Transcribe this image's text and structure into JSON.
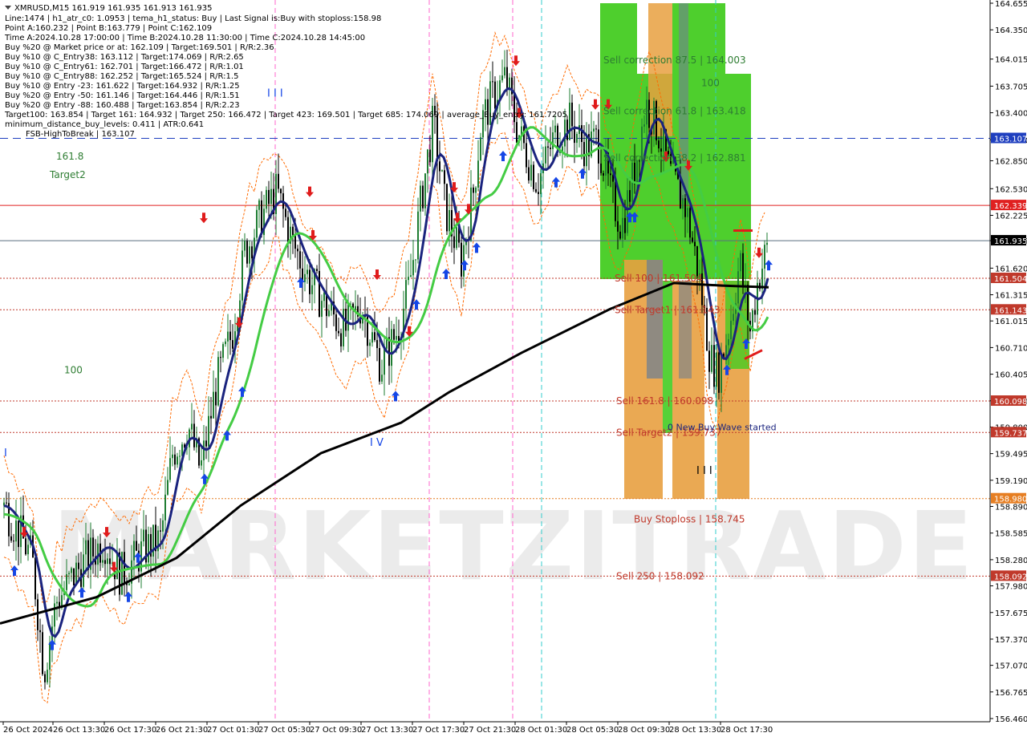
{
  "chart_data": {
    "type": "candlestick",
    "title": "XMRUSD,M15  161.919 161.935 161.913 161.935",
    "info_lines": [
      "Line:1474 | h1_atr_c0: 1.0953 | tema_h1_status: Buy | Last Signal is:Buy with stoploss:158.98",
      "Point A:160.232 | Point B:163.779 | Point C:162.109",
      "Time A:2024.10.28 17:00:00 | Time B:2024.10.28 11:30:00 | Time C:2024.10.28 14:45:00",
      "Buy %20 @ Market price or at: 162.109 | Target:169.501 | R/R:2.36",
      "Buy %10 @ C_Entry38: 163.112 | Target:174.069 | R/R:2.65",
      "Buy %10 @ C_Entry61: 162.701 | Target:166.472 | R/R:1.01",
      "Buy %10 @ C_Entry88: 162.252 | Target:165.524 | R/R:1.5",
      "Buy %10 @ Entry -23: 161.622 | Target:164.932 | R/R:1.25",
      "Buy %20 @ Entry -50: 161.146 | Target:164.446 | R/R:1.51",
      "Buy %20 @ Entry -88: 160.488 | Target:163.854 | R/R:2.23",
      "Target100: 163.854 | Target 161: 164.932 | Target 250: 166.472 | Target 423: 169.501 | Target 685: 174.069 | average_Buy_entry: 161.7205",
      "minimum_distance_buy_levels: 0.411 | ATR:0.641",
      "FSB-HighToBreak | 163.107"
    ],
    "y_ticks": [
      "164.655",
      "164.350",
      "164.015",
      "163.705",
      "163.400",
      "163.090",
      "162.850",
      "162.530",
      "162.225",
      "161.935",
      "161.620",
      "161.315",
      "161.015",
      "160.710",
      "160.405",
      "160.100",
      "159.800",
      "159.495",
      "159.190",
      "158.890",
      "158.585",
      "158.280",
      "157.980",
      "157.675",
      "157.370",
      "157.070",
      "156.765",
      "156.460"
    ],
    "x_labels": [
      "26 Oct 2024",
      "26 Oct 13:30",
      "26 Oct 17:30",
      "26 Oct 21:30",
      "27 Oct 01:30",
      "27 Oct 05:30",
      "27 Oct 09:30",
      "27 Oct 13:30",
      "27 Oct 17:30",
      "27 Oct 21:30",
      "28 Oct 01:30",
      "28 Oct 05:30",
      "28 Oct 09:30",
      "28 Oct 13:30",
      "28 Oct 17:30"
    ],
    "ylim": [
      156.46,
      164.655
    ],
    "current_price": "161.935",
    "price_tags": [
      {
        "value": 163.107,
        "label": "163.107",
        "color": "#1f3fbf",
        "style": "dashed"
      },
      {
        "value": 162.339,
        "label": "162.339",
        "color": "#e02020",
        "style": "solid"
      },
      {
        "value": 161.504,
        "label": "161.504",
        "color": "#c0392b",
        "style": "dotted"
      },
      {
        "value": 161.143,
        "label": "161.143",
        "color": "#c0392b",
        "style": "dotted"
      },
      {
        "value": 160.098,
        "label": "160.098",
        "color": "#c0392b",
        "style": "dotted"
      },
      {
        "value": 159.737,
        "label": "159.737",
        "color": "#c0392b",
        "style": "dotted"
      },
      {
        "value": 158.98,
        "label": "158.980",
        "color": "#e67e22",
        "style": "dotted"
      },
      {
        "value": 158.092,
        "label": "158.092",
        "color": "#c0392b",
        "style": "dotted"
      }
    ],
    "zone_labels": [
      {
        "text": "Sell correction 87.5 | 164.003",
        "price": 164.003,
        "color": "#2e7d32"
      },
      {
        "text": "Sell correction 61.8 | 163.418",
        "price": 163.418,
        "color": "#2e7d32"
      },
      {
        "text": "Sell correction 38.2 | 162.881",
        "price": 162.881,
        "color": "#2e7d32"
      },
      {
        "text": "Sell 100 | 161.504",
        "price": 161.504,
        "color": "#c0392b"
      },
      {
        "text": "Sell Target1 | 161.143",
        "price": 161.143,
        "color": "#c0392b"
      },
      {
        "text": "Sell 161.8 | 160.098",
        "price": 160.098,
        "color": "#c0392b"
      },
      {
        "text": "Sell Target2 | 159.737",
        "price": 159.737,
        "color": "#c0392b"
      },
      {
        "text": "Buy Stoploss | 158.745",
        "price": 158.745,
        "color": "#c0392b"
      },
      {
        "text": "Sell 250 | 158.092",
        "price": 158.092,
        "color": "#c0392b"
      }
    ],
    "side_labels": {
      "fib_161": "161.8",
      "target2": "Target2",
      "fib_100": "100",
      "zone_100": "100"
    },
    "wave_note": "0 New Buy Wave started",
    "roman_marks": {
      "m1": "I I I",
      "m2": "I V",
      "m3": "I I I",
      "m4": "I"
    },
    "watermark": "MARKETZITRADE",
    "series": [
      {
        "name": "EMA Fast",
        "color": "#1a237e"
      },
      {
        "name": "EMA Mid",
        "color": "#44cc44"
      },
      {
        "name": "EMA Slow",
        "color": "#000000"
      }
    ],
    "colors": {
      "bull": "#1e7d32",
      "bear": "#000000",
      "sell_zone": "#e8a040",
      "buy_zone": "#44cc22",
      "grey": "#708090"
    }
  }
}
